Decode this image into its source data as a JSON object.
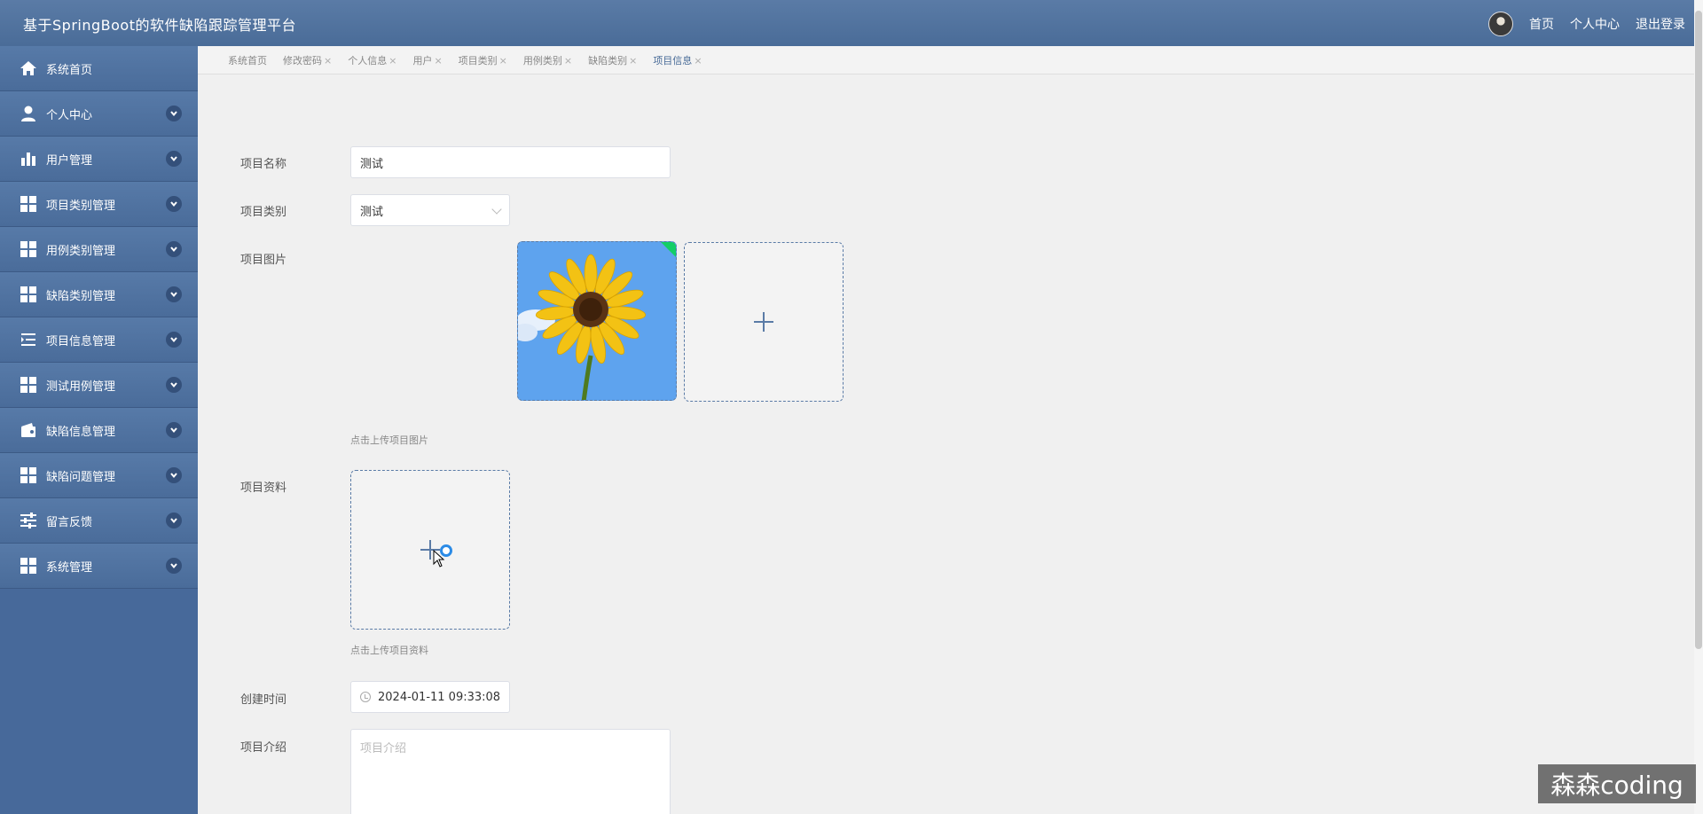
{
  "header": {
    "title": "基于SpringBoot的软件缺陷跟踪管理平台",
    "links": [
      "首页",
      "个人中心",
      "退出登录"
    ]
  },
  "sidebar": {
    "items": [
      {
        "label": "系统首页",
        "icon": "home-icon",
        "expandable": false
      },
      {
        "label": "个人中心",
        "icon": "user-icon",
        "expandable": true
      },
      {
        "label": "用户管理",
        "icon": "bar-chart-icon",
        "expandable": true
      },
      {
        "label": "项目类别管理",
        "icon": "grid-icon",
        "expandable": true
      },
      {
        "label": "用例类别管理",
        "icon": "grid-icon",
        "expandable": true
      },
      {
        "label": "缺陷类别管理",
        "icon": "grid-icon",
        "expandable": true
      },
      {
        "label": "项目信息管理",
        "icon": "list-indent-icon",
        "expandable": true
      },
      {
        "label": "测试用例管理",
        "icon": "grid-icon",
        "expandable": true
      },
      {
        "label": "缺陷信息管理",
        "icon": "wallet-icon",
        "expandable": true
      },
      {
        "label": "缺陷问题管理",
        "icon": "grid-icon",
        "expandable": true
      },
      {
        "label": "留言反馈",
        "icon": "sliders-icon",
        "expandable": true
      },
      {
        "label": "系统管理",
        "icon": "grid-icon",
        "expandable": true
      }
    ]
  },
  "tabs": [
    {
      "label": "系统首页",
      "closable": false,
      "active": false
    },
    {
      "label": "修改密码",
      "closable": true,
      "active": false
    },
    {
      "label": "个人信息",
      "closable": true,
      "active": false
    },
    {
      "label": "用户",
      "closable": true,
      "active": false
    },
    {
      "label": "项目类别",
      "closable": true,
      "active": false
    },
    {
      "label": "用例类别",
      "closable": true,
      "active": false
    },
    {
      "label": "缺陷类别",
      "closable": true,
      "active": false
    },
    {
      "label": "项目信息",
      "closable": true,
      "active": true
    }
  ],
  "tab_close_glyph": "×",
  "form": {
    "name": {
      "label": "项目名称",
      "value": "测试"
    },
    "category": {
      "label": "项目类别",
      "value": "测试"
    },
    "image": {
      "label": "项目图片",
      "hint": "点击上传项目图片"
    },
    "file": {
      "label": "项目资料",
      "hint": "点击上传项目资料"
    },
    "created": {
      "label": "创建时间",
      "value": "2024-01-11 09:33:08"
    },
    "intro": {
      "label": "项目介绍",
      "placeholder": "项目介绍"
    }
  },
  "watermark": "森森coding",
  "colors": {
    "header": "#4a6c98",
    "sidebar": "#47699a",
    "accent": "#5a7ba6",
    "success_corner": "#13ce66"
  }
}
